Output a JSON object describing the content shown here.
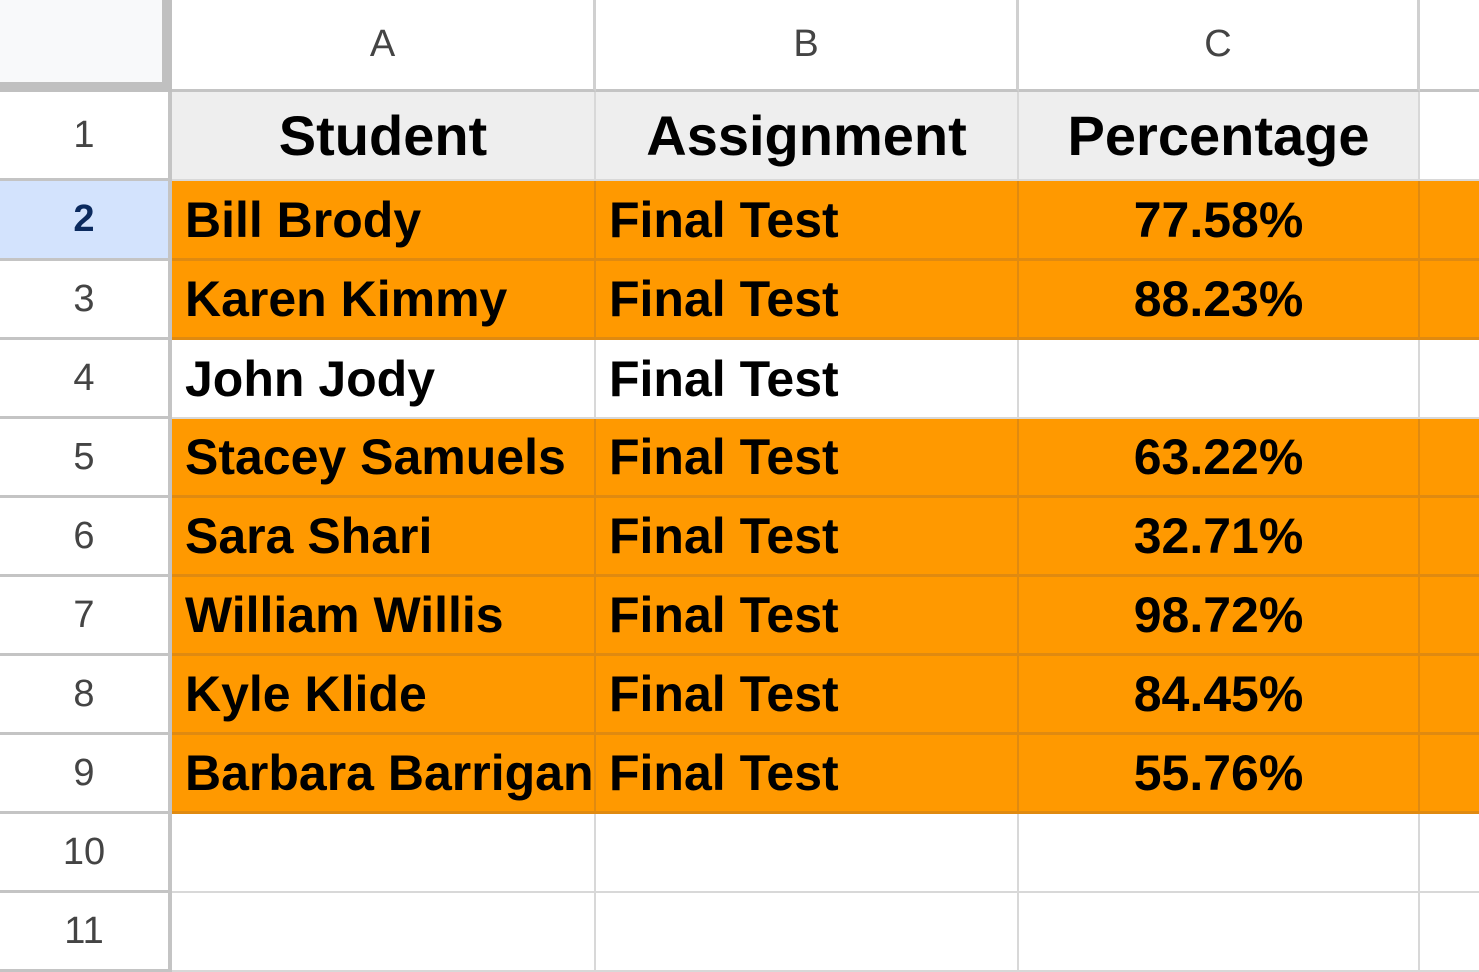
{
  "columns": [
    "A",
    "B",
    "C"
  ],
  "row_numbers": [
    "1",
    "2",
    "3",
    "4",
    "5",
    "6",
    "7",
    "8",
    "9",
    "10",
    "11"
  ],
  "selected_row": "2",
  "highlight_color": "#ff9900",
  "header": {
    "student": "Student",
    "assignment": "Assignment",
    "percentage": "Percentage"
  },
  "rows": [
    {
      "student": "Bill Brody",
      "assignment": "Final Test",
      "percentage": "77.58%",
      "highlighted": true
    },
    {
      "student": "Karen Kimmy",
      "assignment": "Final Test",
      "percentage": "88.23%",
      "highlighted": true
    },
    {
      "student": "John Jody",
      "assignment": "Final Test",
      "percentage": "",
      "highlighted": false
    },
    {
      "student": "Stacey Samuels",
      "assignment": "Final Test",
      "percentage": "63.22%",
      "highlighted": true
    },
    {
      "student": "Sara Shari",
      "assignment": "Final Test",
      "percentage": "32.71%",
      "highlighted": true
    },
    {
      "student": "William Willis",
      "assignment": "Final Test",
      "percentage": "98.72%",
      "highlighted": true
    },
    {
      "student": "Kyle Klide",
      "assignment": "Final Test",
      "percentage": "84.45%",
      "highlighted": true
    },
    {
      "student": "Barbara Barrigan",
      "assignment": "Final Test",
      "percentage": "55.76%",
      "highlighted": true
    }
  ]
}
